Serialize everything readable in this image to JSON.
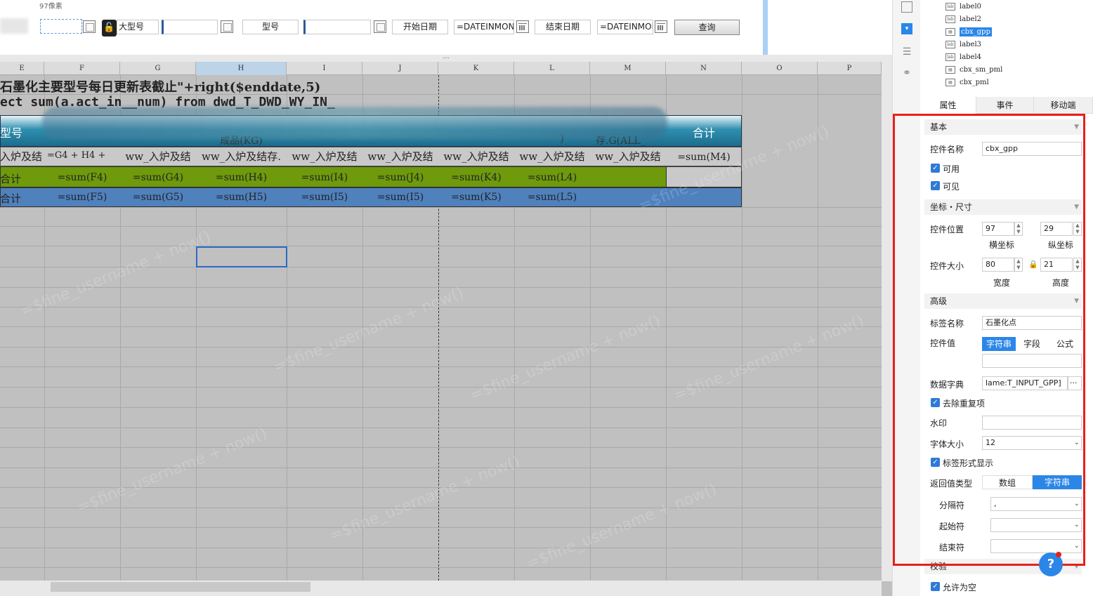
{
  "param": {
    "hint": "97像素",
    "label_dxh": "大型号",
    "label_xh": "型号",
    "label_start": "开始日期",
    "start_value": "=DATEINMONT",
    "label_end": "结束日期",
    "end_value": "=DATEINMON",
    "query_label": "查询"
  },
  "sheet": {
    "splitter": "...",
    "columns": [
      "E",
      "F",
      "G",
      "H",
      "I",
      "J",
      "K",
      "L",
      "M",
      "N",
      "O",
      "P"
    ],
    "title_line": "石墨化主要型号每日更新表截止\"+right($enddate,5)",
    "sql_line": "ect sum(a.act_in__num) from dwd_T_DWD_WY_IN_",
    "header_row": [
      "型号",
      "",
      "",
      "成品(KG)",
      "",
      "",
      "",
      ")",
      "存.G(ALL_",
      "合计"
    ],
    "formula_row": [
      "入炉及结",
      "=G4 + H4 +",
      "ww_入炉及结",
      "ww_入炉及结存.",
      "ww_入炉及结",
      "ww_入炉及结",
      "ww_入炉及结",
      "ww_入炉及结",
      "ww_入炉及结",
      "=sum(M4)"
    ],
    "green_row": [
      "合计",
      "=sum(F4)",
      "=sum(G4)",
      "=sum(H4)",
      "=sum(I4)",
      "=sum(J4)",
      "=sum(K4)",
      "=sum(L4)",
      "",
      ""
    ],
    "blue_row": [
      "合计",
      "=sum(F5)",
      "=sum(G5)",
      "=sum(H5)",
      "=sum(I5)",
      "=sum(I5)",
      "=sum(K5)",
      "=sum(L5)",
      "",
      ""
    ],
    "watermark": "=$fine_username + now()",
    "colors": {
      "green": "#6e9a0c",
      "blue": "#4f81bd",
      "header": "#2f8fb0",
      "grid": "#c0c0c0"
    }
  },
  "tree": {
    "items": [
      "label0",
      "label2",
      "cbx_gpp",
      "label3",
      "label4",
      "cbx_sm_pml",
      "cbx_pml"
    ],
    "selected": "cbx_gpp"
  },
  "tabs": [
    "属性",
    "事件",
    "移动端"
  ],
  "props": {
    "sec_basic": "基本",
    "name_label": "控件名称",
    "name_value": "cbx_gpp",
    "enabled": "可用",
    "visible": "可见",
    "sec_pos": "坐标・尺寸",
    "pos_label": "控件位置",
    "x_value": "97",
    "y_value": "29",
    "x_caption": "横坐标",
    "y_caption": "纵坐标",
    "size_label": "控件大小",
    "w_value": "80",
    "h_value": "21",
    "w_caption": "宽度",
    "h_caption": "高度",
    "sec_adv": "高级",
    "tagname_label": "标签名称",
    "tagname_value": "石墨化点",
    "value_label": "控件值",
    "value_opts": [
      "字符串",
      "字段",
      "公式"
    ],
    "dict_label": "数据字典",
    "dict_value": "lame:T_INPUT_GPP]",
    "dict_btn": "···",
    "dedupe": "去除重复项",
    "watermark_label": "水印",
    "fontsize_label": "字体大小",
    "fontsize_value": "12",
    "tagshow": "标签形式显示",
    "rettype_label": "返回值类型",
    "rettype_opts": [
      "数组",
      "字符串"
    ],
    "sep_label": "分隔符",
    "sep_value": ",",
    "start_label": "起始符",
    "end_label": "结束符",
    "verify_label": "校验",
    "allow_empty": "允许为空"
  }
}
